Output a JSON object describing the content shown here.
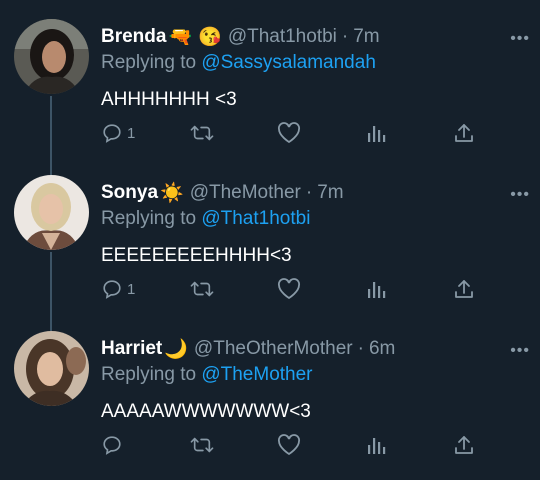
{
  "colors": {
    "background": "#15202b",
    "muted": "#8899a6",
    "link": "#1da1f2",
    "thread": "#3d5466"
  },
  "tweets": [
    {
      "name": "Brenda",
      "emoji_1": "🔫",
      "emoji_2": "😘",
      "handle": "@That1hotbi",
      "dot": "·",
      "time": "7m",
      "more": "•••",
      "reply_prefix": "Replying to",
      "reply_handle": "@Sassysalamandah",
      "text": "AHHHHHHH <3",
      "reply_count": "1"
    },
    {
      "name": "Sonya",
      "emoji_1": "☀️",
      "handle": "@TheMother",
      "dot": "·",
      "time": "7m",
      "more": "•••",
      "reply_prefix": "Replying to",
      "reply_handle": "@That1hotbi",
      "text": "EEEEEEEEEHHHH<3",
      "reply_count": "1"
    },
    {
      "name": "Harriet",
      "emoji_1": "🌙",
      "handle": "@TheOtherMother",
      "dot": "·",
      "time": "6m",
      "more": "•••",
      "reply_prefix": "Replying to",
      "reply_handle": "@TheMother",
      "text": "AAAAAWWWWWWW<3",
      "reply_count": ""
    }
  ],
  "icons": [
    "reply-icon",
    "retweet-icon",
    "like-icon",
    "analytics-icon",
    "share-icon"
  ]
}
